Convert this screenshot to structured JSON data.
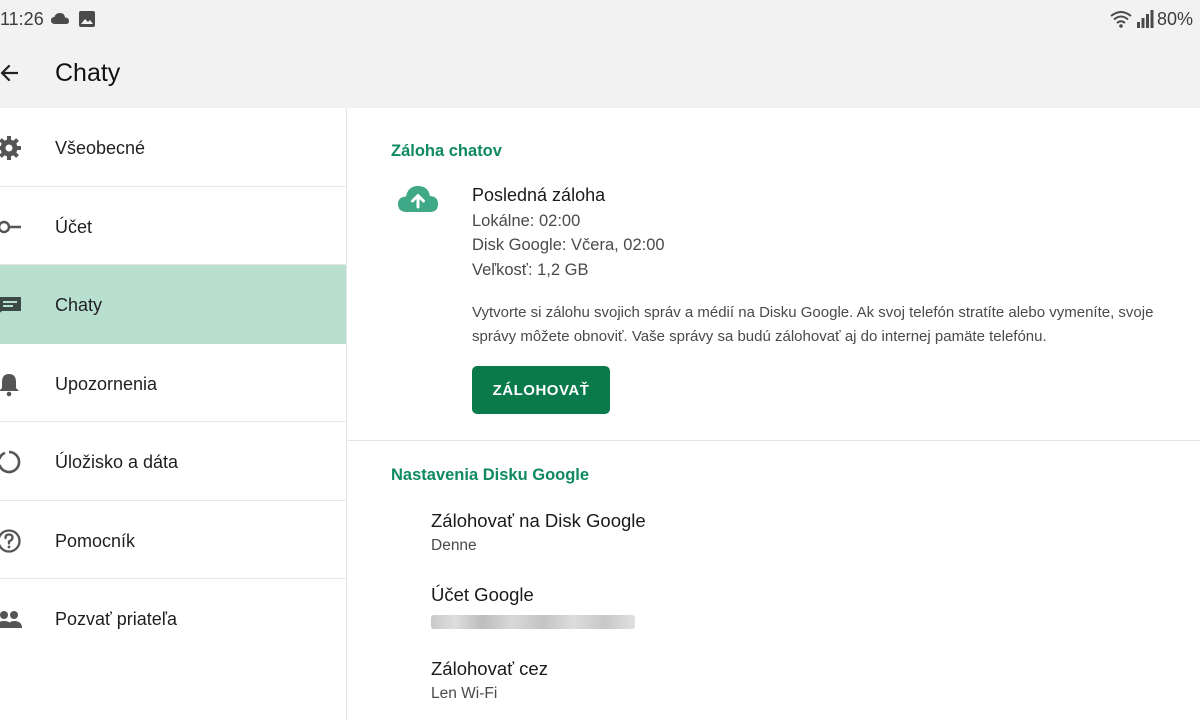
{
  "status_bar": {
    "time": "11:26",
    "battery": "80%",
    "icons": [
      "cloud-icon",
      "image-icon",
      "wifi-icon",
      "signal-icon"
    ]
  },
  "app_bar": {
    "title": "Chaty",
    "back_icon": "arrow-left-icon"
  },
  "sidebar": {
    "items": [
      {
        "label": "Všeobecné",
        "icon": "gear-icon",
        "active": false
      },
      {
        "label": "Účet",
        "icon": "key-icon",
        "active": false
      },
      {
        "label": "Chaty",
        "icon": "chat-icon",
        "active": true
      },
      {
        "label": "Upozornenia",
        "icon": "bell-icon",
        "active": false
      },
      {
        "label": "Úložisko a dáta",
        "icon": "storage-circle-icon",
        "active": false
      },
      {
        "label": "Pomocník",
        "icon": "help-circle-icon",
        "active": false
      },
      {
        "label": "Pozvať priateľa",
        "icon": "people-icon",
        "active": false
      }
    ]
  },
  "backup_section": {
    "title": "Záloha chatov",
    "icon": "cloud-upload-icon",
    "last_backup_label": "Posledná záloha",
    "local": "Lokálne: 02:00",
    "google_drive": "Disk Google: Včera, 02:00",
    "size": "Veľkosť: 1,2 GB",
    "description": "Vytvorte si zálohu svojich správ a médií na Disku Google. Ak svoj telefón stratíte alebo vymeníte, svoje správy môžete obnoviť. Vaše správy sa budú zálohovať aj do internej pamäte telefónu.",
    "button_label": "ZÁLOHOVAŤ"
  },
  "drive_settings": {
    "title": "Nastavenia Disku Google",
    "backup_to_drive": {
      "label": "Zálohovať na Disk Google",
      "value": "Denne"
    },
    "google_account": {
      "label": "Účet Google",
      "value_redacted": true
    },
    "backup_over": {
      "label": "Zálohovať cez",
      "value": "Len Wi-Fi"
    }
  },
  "colors": {
    "accent": "#0f8a5f",
    "button": "#0a7a4b",
    "active_nav": "#b9dfd0",
    "bar_background": "#f2f2f2"
  }
}
